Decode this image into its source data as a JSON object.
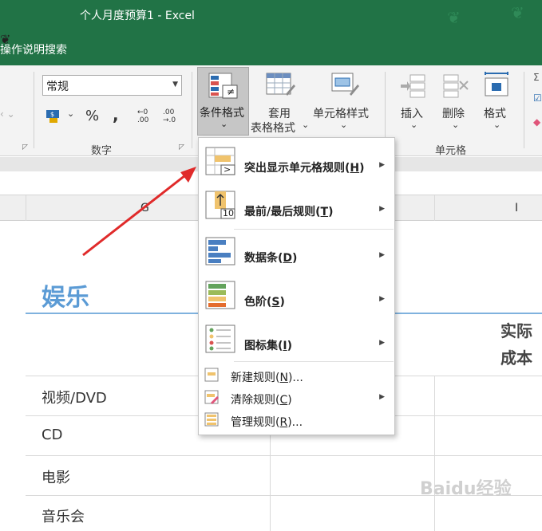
{
  "window": {
    "title": "个人月度预算1  -  Excel"
  },
  "tell_me": {
    "text": "操作说明搜索"
  },
  "ribbon": {
    "number_format": "常规",
    "percent": "%",
    "comma": ",",
    "decimal_inc_top": "←0",
    "decimal_inc_bottom": ".00",
    "decimal_dec_top": ".00",
    "decimal_dec_bottom": "→.0",
    "number_group": "数字",
    "conditional_formatting": "条件格式",
    "format_as_table_1": "套用",
    "format_as_table_2": "表格格式",
    "cell_styles": "单元格样式",
    "insert": "插入",
    "delete": "删除",
    "format": "格式",
    "cells_group": "单元格",
    "dropdown_caret": "⌄",
    "launcher": "◸"
  },
  "columns": {
    "g": "G",
    "i": "I"
  },
  "sheet": {
    "heading": "娱乐",
    "actual_cost_1": "实际",
    "actual_cost_2": "成本",
    "rows": [
      "视频/DVD",
      "CD",
      "电影",
      "音乐会"
    ]
  },
  "menu": {
    "items": [
      {
        "pre": "突出显示单元格规则(",
        "key": "H",
        "post": ")"
      },
      {
        "pre": "最前/最后规则(",
        "key": "T",
        "post": ")"
      },
      {
        "pre": "数据条(",
        "key": "D",
        "post": ")"
      },
      {
        "pre": "色阶(",
        "key": "S",
        "post": ")"
      },
      {
        "pre": "图标集(",
        "key": "I",
        "post": ")"
      }
    ],
    "small": [
      {
        "pre": "新建规则(",
        "key": "N",
        "post": ")..."
      },
      {
        "pre": "清除规则(",
        "key": "C",
        "post": ")"
      },
      {
        "pre": "管理规则(",
        "key": "R",
        "post": ")..."
      }
    ],
    "icon_text_top10": "10",
    "icon_text_neq": "≠",
    "icon_text_gt": ">"
  },
  "watermark": {
    "text": "Baidu经验"
  },
  "colors": {
    "excel_green": "#217346",
    "heading_blue": "#5b9bd5",
    "arrow_red": "#e02a2a"
  }
}
